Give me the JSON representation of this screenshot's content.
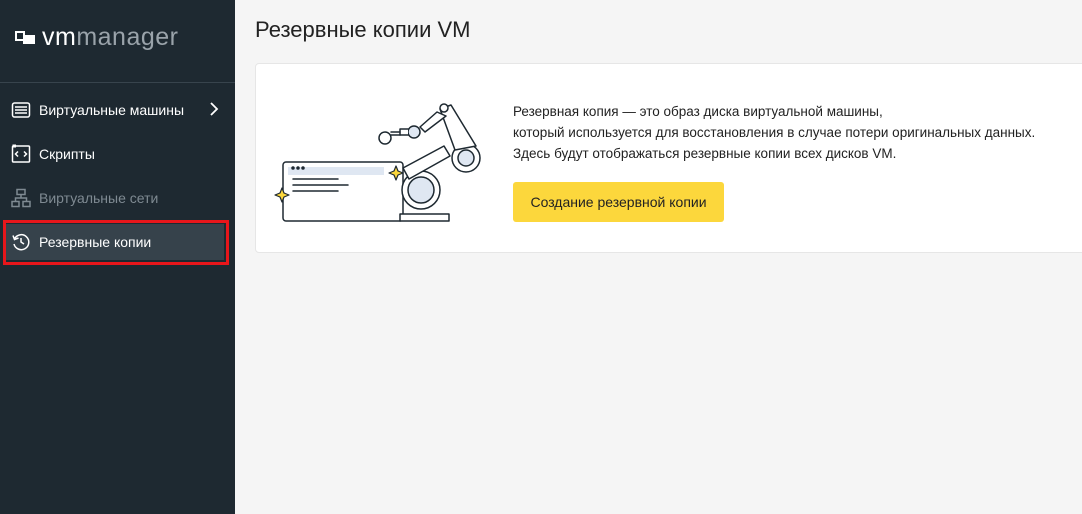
{
  "app": {
    "logo_vm": "vm",
    "logo_manager": "manager"
  },
  "sidebar": {
    "items": [
      {
        "label": "Виртуальные машины",
        "icon": "virtual-machines-icon",
        "state": "normal",
        "has_submenu": true
      },
      {
        "label": "Скрипты",
        "icon": "scripts-icon",
        "state": "normal",
        "has_submenu": false
      },
      {
        "label": "Виртуальные сети",
        "icon": "network-icon",
        "state": "disabled",
        "has_submenu": false
      },
      {
        "label": "Резервные копии",
        "icon": "backup-icon",
        "state": "active",
        "has_submenu": false
      }
    ],
    "highlight_color": "#e8161b"
  },
  "main": {
    "title": "Резервные копии VM",
    "empty_state": {
      "description_lines": [
        "Резервная копия — это образ диска виртуальной машины,",
        "который используется для восстановления в случае потери оригинальных данных.",
        "Здесь будут отображаться резервные копии всех дисков VM."
      ],
      "create_button_label": "Создание резервной копии",
      "illustration": "robot-arm-illustration",
      "button_color": "#fcd73c"
    }
  }
}
